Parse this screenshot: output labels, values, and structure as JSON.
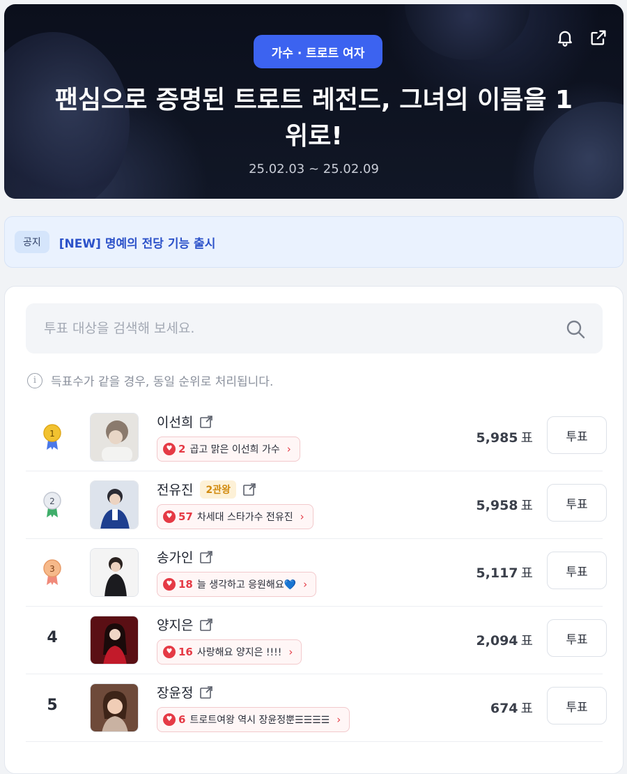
{
  "hero": {
    "category": "가수 · 트로트 여자",
    "title": "팬심으로 증명된 트로트 레전드, 그녀의 이름을 1위로!",
    "date_range": "25.02.03 ~ 25.02.09",
    "icons": [
      "bell-icon",
      "share-icon"
    ]
  },
  "notice": {
    "tag": "공지",
    "text": "[NEW] 명예의 전당 기능 출시"
  },
  "search": {
    "placeholder": "투표 대상을 검색해 보세요."
  },
  "info_text": "득표수가 같을 경우, 동일 순위로 처리됩니다.",
  "ranking": [
    {
      "rank": "1",
      "medal": "gold",
      "name": "이선희",
      "badge": "",
      "cheer_count": "2",
      "cheer_msg": "곱고 맑은 이선희 가수",
      "votes": "5,985",
      "unit": "표",
      "vote_label": "투표"
    },
    {
      "rank": "2",
      "medal": "silver",
      "name": "전유진",
      "badge": "2관왕",
      "cheer_count": "57",
      "cheer_msg": "차세대 스타가수 전유진",
      "votes": "5,958",
      "unit": "표",
      "vote_label": "투표"
    },
    {
      "rank": "3",
      "medal": "bronze",
      "name": "송가인",
      "badge": "",
      "cheer_count": "18",
      "cheer_msg": "늘 생각하고 응원해요💙",
      "votes": "5,117",
      "unit": "표",
      "vote_label": "투표"
    },
    {
      "rank": "4",
      "medal": "",
      "name": "양지은",
      "badge": "",
      "cheer_count": "16",
      "cheer_msg": "사랑해요 양지은 !!!!",
      "votes": "2,094",
      "unit": "표",
      "vote_label": "투표"
    },
    {
      "rank": "5",
      "medal": "",
      "name": "장윤정",
      "badge": "",
      "cheer_count": "6",
      "cheer_msg": "트로트여왕 역시 장윤정뿐☰☰☰☰",
      "votes": "674",
      "unit": "표",
      "vote_label": "투표"
    }
  ],
  "colors": {
    "accent": "#3c63f0",
    "heart": "#e53a45",
    "gold": "#f2c230",
    "silver": "#c9ced8",
    "bronze": "#f0a070"
  }
}
